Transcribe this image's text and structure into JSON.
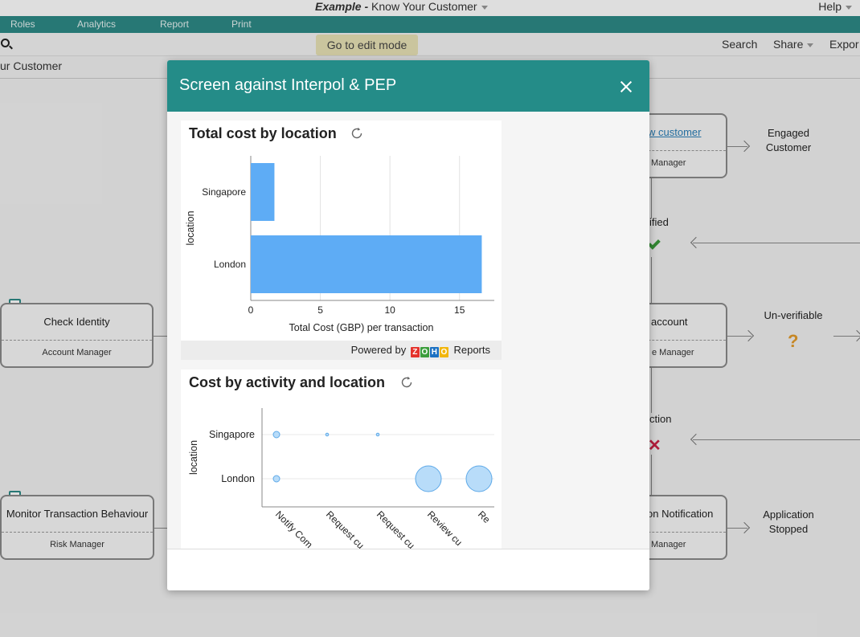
{
  "app": {
    "title_prefix": "Example -",
    "title": "Know Your Customer",
    "help": "Help"
  },
  "nav": {
    "items": [
      "Roles",
      "Analytics",
      "Report",
      "Print"
    ]
  },
  "toolbar": {
    "edit_mode": "Go to edit mode",
    "search": "Search",
    "share": "Share",
    "export": "Expor"
  },
  "breadcrumb": "ur Customer",
  "process": {
    "boxes": [
      {
        "name": "Check Identity",
        "role": "Account Manager"
      },
      {
        "name": "Monitor Transaction Behaviour",
        "role": "Risk Manager"
      },
      {
        "name": "w customer",
        "role": "Manager"
      },
      {
        "name": "account",
        "role": "e Manager"
      },
      {
        "name": "on Notification",
        "role": "Manager"
      }
    ],
    "labels": {
      "engaged": "Engaged Customer",
      "unverifiable": "Un-verifiable",
      "stopped": "Application Stopped",
      "verified": "ified",
      "action": "ction"
    }
  },
  "modal": {
    "title": "Screen against Interpol & PEP",
    "powered_by": "Powered by",
    "reports": "Reports",
    "logo_letters": [
      "Z",
      "O",
      "H",
      "O"
    ],
    "logo_colors": [
      "#e4322b",
      "#3c9d3c",
      "#1c71c2",
      "#f2b60c"
    ]
  },
  "chart_data": [
    {
      "type": "bar",
      "title": "Total cost by location",
      "categories": [
        "Singapore",
        "London"
      ],
      "values": [
        1.7,
        16.6
      ],
      "xlabel": "Total Cost (GBP) per transaction",
      "ylabel": "location",
      "xlim": [
        0,
        17.5
      ],
      "xticks": [
        0,
        5,
        10,
        15
      ],
      "color": "#5eacf5",
      "grid": true
    },
    {
      "type": "scatter",
      "title": "Cost by activity and location",
      "ylabel": "location",
      "y_categories": [
        "Singapore",
        "London"
      ],
      "x_categories": [
        "Notify Com",
        "Request cu",
        "Request cu",
        "Review cu",
        "Re"
      ],
      "points": [
        {
          "x": "Notify Com",
          "y": "Singapore",
          "size": 1
        },
        {
          "x": "Request cu",
          "y": "Singapore",
          "size": 0.2
        },
        {
          "x": "Request cu",
          "y": "Singapore",
          "size": 0.2,
          "index": 2
        },
        {
          "x": "Notify Com",
          "y": "London",
          "size": 1
        },
        {
          "x": "Review cu",
          "y": "London",
          "size": 16
        },
        {
          "x": "Re",
          "y": "London",
          "size": 16
        }
      ],
      "color": "#b8dcf9"
    }
  ]
}
